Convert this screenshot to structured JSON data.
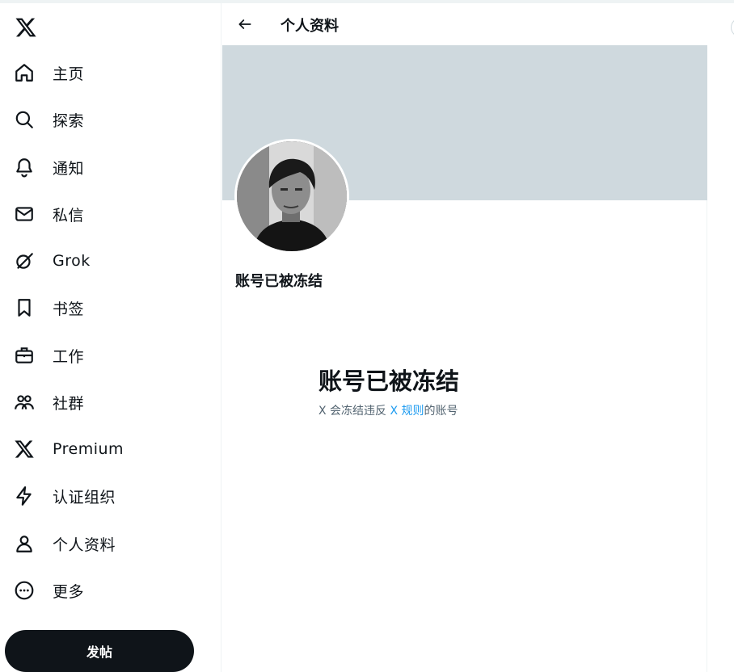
{
  "header": {
    "title": "个人资料"
  },
  "sidebar": {
    "items": [
      {
        "label": "主页",
        "icon": "home-icon"
      },
      {
        "label": "探索",
        "icon": "search-icon"
      },
      {
        "label": "通知",
        "icon": "bell-icon"
      },
      {
        "label": "私信",
        "icon": "mail-icon"
      },
      {
        "label": "Grok",
        "icon": "grok-icon"
      },
      {
        "label": "书签",
        "icon": "bookmark-icon"
      },
      {
        "label": "工作",
        "icon": "briefcase-icon"
      },
      {
        "label": "社群",
        "icon": "communities-icon"
      },
      {
        "label": "Premium",
        "icon": "x-logo-icon"
      },
      {
        "label": "认证组织",
        "icon": "lightning-icon"
      },
      {
        "label": "个人资料",
        "icon": "person-icon"
      },
      {
        "label": "更多",
        "icon": "more-circle-icon"
      }
    ],
    "post_button": "发帖"
  },
  "profile": {
    "name": "账号已被冻结",
    "banner_color": "#cfd9de"
  },
  "suspended": {
    "title": "账号已被冻结",
    "desc_prefix": "X 会冻结违反 ",
    "rules_link": "X 规则",
    "desc_suffix": "的账号"
  },
  "colors": {
    "text": "#0f1419",
    "secondary": "#536471",
    "accent": "#1d9bf0",
    "button_bg": "#0f1419"
  }
}
